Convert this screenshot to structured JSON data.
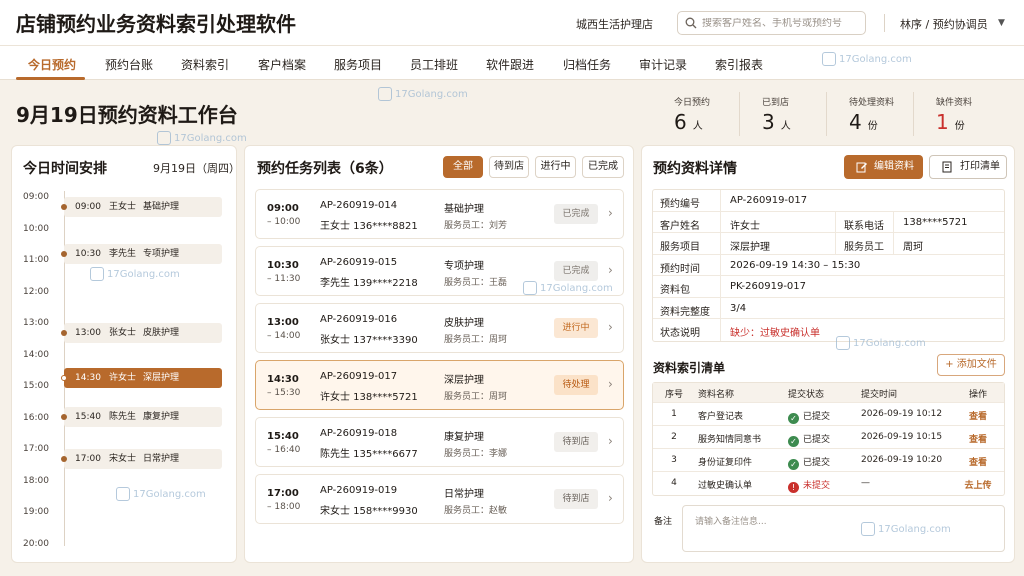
{
  "app": {
    "title": "店铺预约业务资料索引处理软件",
    "store": "城西生活护理店",
    "search_placeholder": "搜索客户姓名、手机号或预约号",
    "user": "林序 / 预约协调员",
    "caret": "▼"
  },
  "nav": [
    "今日预约",
    "预约台账",
    "资料索引",
    "客户档案",
    "服务项目",
    "员工排班",
    "软件跟进",
    "归档任务",
    "审计记录",
    "索引报表"
  ],
  "watermark": "17Golang.com",
  "workspace": {
    "title": "9月19日预约资料工作台",
    "stats": [
      {
        "label": "今日预约",
        "value": "6",
        "unit": "人",
        "alert": false
      },
      {
        "label": "已到店",
        "value": "3",
        "unit": "人",
        "alert": false
      },
      {
        "label": "待处理资料",
        "value": "4",
        "unit": "份",
        "alert": false
      },
      {
        "label": "缺件资料",
        "value": "1",
        "unit": "份",
        "alert": true
      }
    ]
  },
  "schedule": {
    "title": "今日时间安排",
    "date": "9月19日（周四）",
    "hours": [
      "09:00",
      "10:00",
      "11:00",
      "12:00",
      "13:00",
      "14:00",
      "15:00",
      "16:00",
      "17:00",
      "18:00",
      "19:00",
      "20:00"
    ],
    "items": [
      {
        "time": "09:00",
        "name": "王女士",
        "service": "基础护理",
        "active": false
      },
      {
        "time": "10:30",
        "name": "李先生",
        "service": "专项护理",
        "active": false
      },
      {
        "time": "13:00",
        "name": "张女士",
        "service": "皮肤护理",
        "active": false
      },
      {
        "time": "14:30",
        "name": "许女士",
        "service": "深层护理",
        "active": true
      },
      {
        "time": "15:40",
        "name": "陈先生",
        "service": "康复护理",
        "active": false
      },
      {
        "time": "17:00",
        "name": "宋女士",
        "service": "日常护理",
        "active": false
      }
    ]
  },
  "tasks": {
    "title": "预约任务列表（6条）",
    "filters": [
      "全部",
      "待到店",
      "进行中",
      "已完成"
    ],
    "items": [
      {
        "start": "09:00",
        "end": "– 10:00",
        "code": "AP-260919-014",
        "customer": "王女士  136****8821",
        "service": "基础护理",
        "staff": "服务员工：刘芳",
        "status": "已完成",
        "status_type": "done",
        "active": false
      },
      {
        "start": "10:30",
        "end": "– 11:30",
        "code": "AP-260919-015",
        "customer": "李先生  139****2218",
        "service": "专项护理",
        "staff": "服务员工：王磊",
        "status": "已完成",
        "status_type": "done",
        "active": false
      },
      {
        "start": "13:00",
        "end": "– 14:00",
        "code": "AP-260919-016",
        "customer": "张女士  137****3390",
        "service": "皮肤护理",
        "staff": "服务员工：周珂",
        "status": "进行中",
        "status_type": "doing",
        "active": false
      },
      {
        "start": "14:30",
        "end": "– 15:30",
        "code": "AP-260919-017",
        "customer": "许女士  138****5721",
        "service": "深层护理",
        "staff": "服务员工：周珂",
        "status": "待处理",
        "status_type": "pending",
        "active": true
      },
      {
        "start": "15:40",
        "end": "– 16:40",
        "code": "AP-260919-018",
        "customer": "陈先生  135****6677",
        "service": "康复护理",
        "staff": "服务员工：李娜",
        "status": "待到店",
        "status_type": "wait",
        "active": false
      },
      {
        "start": "17:00",
        "end": "– 18:00",
        "code": "AP-260919-019",
        "customer": "宋女士  158****9930",
        "service": "日常护理",
        "staff": "服务员工：赵敏",
        "status": "待到店",
        "status_type": "wait",
        "active": false
      }
    ]
  },
  "detail": {
    "title": "预约资料详情",
    "edit_label": "编辑资料",
    "print_label": "打印清单",
    "fields": {
      "code_k": "预约编号",
      "code_v": "AP-260919-017",
      "name_k": "客户姓名",
      "name_v": "许女士",
      "phone_k": "联系电话",
      "phone_v": "138****5721",
      "svc_k": "服务项目",
      "svc_v": "深层护理",
      "staff_k": "服务员工",
      "staff_v": "周珂",
      "time_k": "预约时间",
      "time_v": "2026-09-19 14:30 – 15:30",
      "pack_k": "资料包",
      "pack_v": "PK-260919-017",
      "comp_k": "资料完整度",
      "comp_v": "3/4",
      "state_k": "状态说明",
      "state_v": "缺少：过敏史确认单"
    },
    "index_title": "资料索引清单",
    "add_label": "+ 添加文件",
    "columns": [
      "序号",
      "资料名称",
      "提交状态",
      "提交时间",
      "操作"
    ],
    "rows": [
      {
        "no": "1",
        "name": "客户登记表",
        "status": "已提交",
        "ok": true,
        "time": "2026-09-19 10:12",
        "op": "查看"
      },
      {
        "no": "2",
        "name": "服务知情同意书",
        "status": "已提交",
        "ok": true,
        "time": "2026-09-19 10:15",
        "op": "查看"
      },
      {
        "no": "3",
        "name": "身份证复印件",
        "status": "已提交",
        "ok": true,
        "time": "2026-09-19 10:20",
        "op": "查看"
      },
      {
        "no": "4",
        "name": "过敏史确认单",
        "status": "未提交",
        "ok": false,
        "time": "—",
        "op": "去上传"
      }
    ],
    "note_label": "备注",
    "note_placeholder": "请输入备注信息..."
  }
}
